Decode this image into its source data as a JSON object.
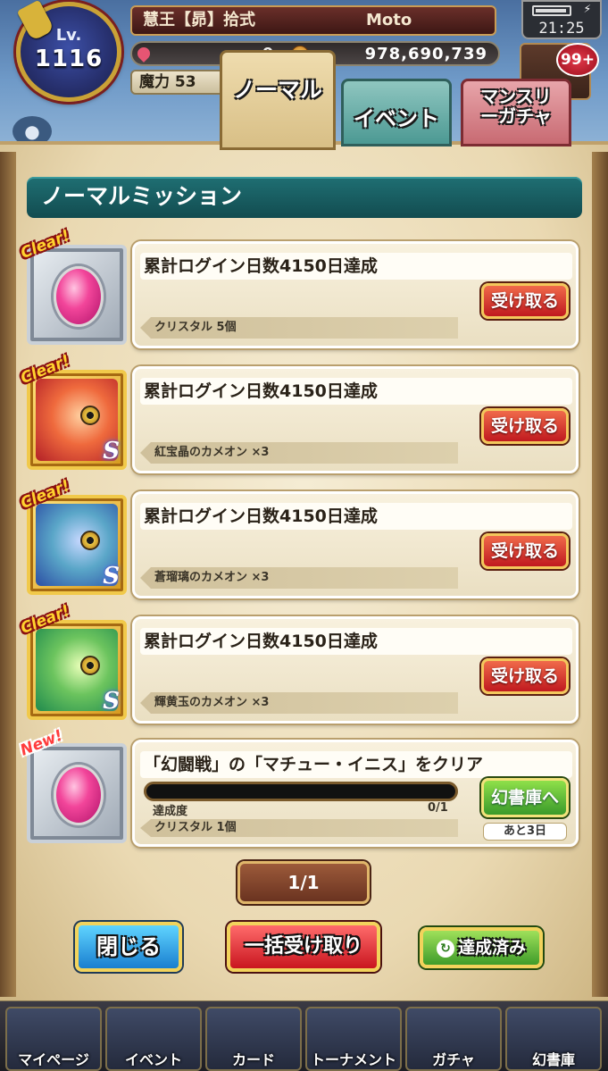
{
  "hud": {
    "level_label": "Lv.",
    "level": "1116",
    "title": "慧王【昴】拾式",
    "player_name": "Moto",
    "currency_left": "9",
    "currency_right": "978,690,739",
    "mana_label": "魔力 53",
    "time": "21:25",
    "badge": "99+"
  },
  "tabs": [
    {
      "label": "ノーマル",
      "active": true
    },
    {
      "label": "イベント",
      "active": false
    },
    {
      "label": "マンスリーガチャ",
      "active": false
    }
  ],
  "section_title": "ノーマルミッション",
  "missions": [
    {
      "status": "Clear!",
      "title": "累計ログイン日数4150日達成",
      "reward": "クリスタル 5個",
      "button": "受け取る",
      "icon": "crystal-icon"
    },
    {
      "status": "Clear!",
      "title": "累計ログイン日数4150日達成",
      "reward": "紅宝晶のカメオン ×3",
      "button": "受け取る",
      "icon": "red-chameleon-icon"
    },
    {
      "status": "Clear!",
      "title": "累計ログイン日数4150日達成",
      "reward": "蒼瑠璃のカメオン ×3",
      "button": "受け取る",
      "icon": "blue-chameleon-icon"
    },
    {
      "status": "Clear!",
      "title": "累計ログイン日数4150日達成",
      "reward": "輝黄玉のカメオン ×3",
      "button": "受け取る",
      "icon": "green-chameleon-icon"
    },
    {
      "status": "New!",
      "title": "「幻闘戦」の「マチュー・イニス」をクリア",
      "reward": "クリスタル 1個",
      "button": "幻書庫へ",
      "progress_label": "達成度",
      "progress_text": "0/1",
      "progress_value": 0,
      "remaining": "あと3日",
      "icon": "crystal-icon"
    }
  ],
  "pager": "1/1",
  "footer": {
    "close": "閉じる",
    "bulk_receive": "一括受け取り",
    "achieved": "達成済み"
  },
  "bottom_nav": [
    "マイページ",
    "イベント",
    "カード",
    "トーナメント",
    "ガチャ",
    "幻書庫"
  ],
  "colors": {
    "header_teal": "#1f6f73",
    "receive_red": "#c0191f",
    "parchment": "#ead9b2"
  }
}
